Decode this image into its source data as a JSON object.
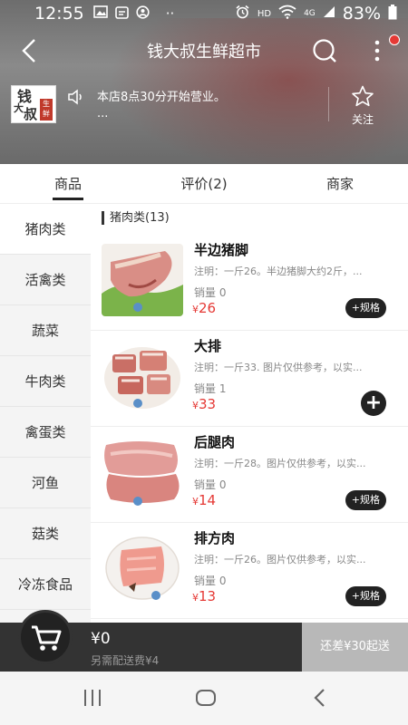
{
  "status_bar": {
    "time": "12:55",
    "left_icons": [
      "image-icon",
      "calendar-icon",
      "face-icon"
    ],
    "dots": "··",
    "hd": "HD",
    "network": "4G",
    "battery": "83%"
  },
  "nav": {
    "title": "钱大叔生鲜超市"
  },
  "shop": {
    "logo_chars": [
      "钱",
      "大",
      "叔"
    ],
    "logo_stamp": "生鲜",
    "notice": "本店8点30分开始营业。",
    "notice_more": "...",
    "follow_label": "关注"
  },
  "tabs": [
    {
      "label": "商品"
    },
    {
      "label": "评价(2)"
    },
    {
      "label": "商家"
    }
  ],
  "categories": [
    {
      "label": "猪肉类"
    },
    {
      "label": "活禽类"
    },
    {
      "label": "蔬菜"
    },
    {
      "label": "牛肉类"
    },
    {
      "label": "禽蛋类"
    },
    {
      "label": "河鱼"
    },
    {
      "label": "菇类"
    },
    {
      "label": "冷冻食品"
    }
  ],
  "section_title": "猪肉类(13)",
  "products": [
    {
      "name": "半边猪脚",
      "note": "注明：一斤26。半边猪脚大约2斤，...",
      "sales": "销量 0",
      "currency": "¥",
      "price": "26",
      "action": "+规格"
    },
    {
      "name": "大排",
      "note": "注明：一斤33. 图片仅供参考，以实...",
      "sales": "销量 1",
      "currency": "¥",
      "price": "33",
      "action": "+"
    },
    {
      "name": "后腿肉",
      "note": "注明：一斤28。图片仅供参考，以实...",
      "sales": "销量 0",
      "currency": "¥",
      "price": "14",
      "action": "+规格"
    },
    {
      "name": "排方肉",
      "note": "注明：一斤26。图片仅供参考，以实...",
      "sales": "销量 0",
      "currency": "¥",
      "price": "13",
      "action": "+规格"
    }
  ],
  "cart": {
    "total": "¥0",
    "delivery_fee": "另需配送费¥4",
    "checkout_label": "还差¥30起送"
  },
  "colors": {
    "price_red": "#e53935",
    "dark": "#222222",
    "cart_bar": "#333333"
  }
}
